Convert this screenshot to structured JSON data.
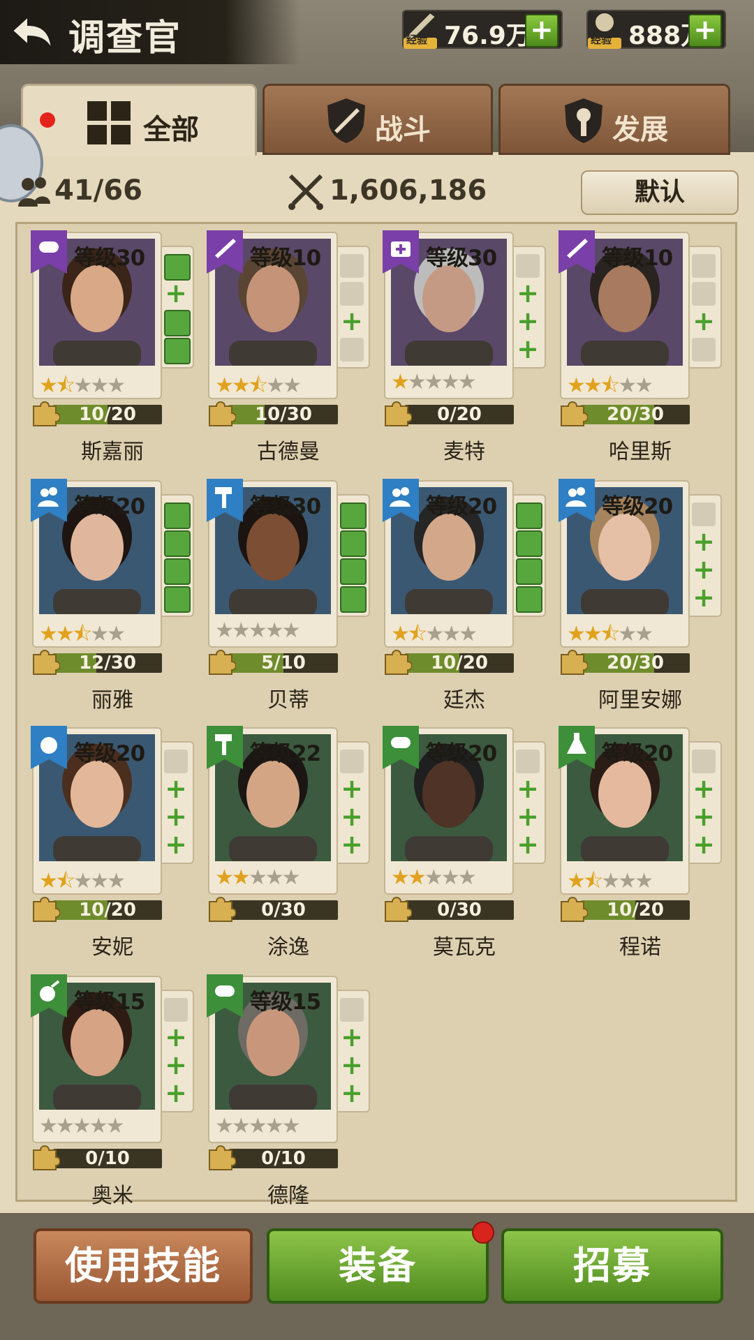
{
  "header": {
    "title": "调查官"
  },
  "resources": [
    {
      "icon": "rifle-exp-icon",
      "tag": "经验",
      "value": "76.9万"
    },
    {
      "icon": "wrench-exp-icon",
      "tag": "经验",
      "value": "888万"
    }
  ],
  "tabs": [
    {
      "label": "全部",
      "icon": "grid-icon",
      "active": true
    },
    {
      "label": "战斗",
      "icon": "combat-shield-icon",
      "active": false
    },
    {
      "label": "发展",
      "icon": "wrench-shield-icon",
      "active": false
    }
  ],
  "stats": {
    "count": "41/66",
    "power": "1,606,186",
    "sort_label": "默认"
  },
  "level_prefix": "等级",
  "investigators": [
    {
      "name": "斯嘉丽",
      "level": "30",
      "badge_color": "#7a3fa8",
      "badge_icon": "roll-icon",
      "stars": 1.5,
      "progress": "10/20",
      "pct": 0.5,
      "slots": [
        "gear",
        "plus",
        "gear",
        "gear"
      ],
      "bg": "#5a4868",
      "skin": "#d9a887",
      "hair": "#3b2418"
    },
    {
      "name": "古德曼",
      "level": "10",
      "badge_color": "#7a3fa8",
      "badge_icon": "rifle-icon",
      "stars": 2.5,
      "progress": "10/30",
      "pct": 0.33,
      "slots": [
        "empty",
        "empty",
        "plus",
        "empty"
      ],
      "bg": "#5a4868",
      "skin": "#c59478",
      "hair": "#5a4433"
    },
    {
      "name": "麦特",
      "level": "30",
      "badge_color": "#7a3fa8",
      "badge_icon": "medkit-icon",
      "stars": 1,
      "progress": "0/20",
      "pct": 0,
      "slots": [
        "empty",
        "plus",
        "plus",
        "plus"
      ],
      "bg": "#5a4868",
      "skin": "#c59a85",
      "hair": "#bcbcbc"
    },
    {
      "name": "哈里斯",
      "level": "10",
      "badge_color": "#7a3fa8",
      "badge_icon": "rifle-icon",
      "stars": 2.5,
      "progress": "20/30",
      "pct": 0.67,
      "slots": [
        "empty",
        "empty",
        "plus",
        "empty"
      ],
      "bg": "#5a4868",
      "skin": "#a87a5f",
      "hair": "#2a2420"
    },
    {
      "name": "丽雅",
      "level": "20",
      "badge_color": "#2f7fc4",
      "badge_icon": "people-icon",
      "stars": 2.5,
      "progress": "12/30",
      "pct": 0.4,
      "slots": [
        "gear",
        "gear",
        "gear",
        "gear"
      ],
      "bg": "#3b5872",
      "skin": "#e0b79c",
      "hair": "#1e1512"
    },
    {
      "name": "贝蒂",
      "level": "30",
      "badge_color": "#2f7fc4",
      "badge_icon": "hammer-icon",
      "stars": 0,
      "progress": "5/10",
      "pct": 0.5,
      "slots": [
        "gear",
        "gear",
        "gear",
        "gear"
      ],
      "bg": "#3b5872",
      "skin": "#7c4e34",
      "hair": "#1b1410"
    },
    {
      "name": "廷杰",
      "level": "20",
      "badge_color": "#2f7fc4",
      "badge_icon": "people-icon",
      "stars": 1.5,
      "progress": "10/20",
      "pct": 0.5,
      "slots": [
        "gear",
        "gear",
        "gear",
        "gear"
      ],
      "bg": "#3b5872",
      "skin": "#d3a88a",
      "hair": "#262626"
    },
    {
      "name": "阿里安娜",
      "level": "20",
      "badge_color": "#2f7fc4",
      "badge_icon": "people-icon",
      "stars": 2.5,
      "progress": "20/30",
      "pct": 0.67,
      "slots": [
        "empty",
        "plus",
        "plus",
        "plus"
      ],
      "bg": "#3b5872",
      "skin": "#e6c0a6",
      "hair": "#a6845e"
    },
    {
      "name": "安妮",
      "level": "20",
      "badge_color": "#2f7fc4",
      "badge_icon": "tomato-icon",
      "stars": 1.5,
      "progress": "10/20",
      "pct": 0.5,
      "slots": [
        "empty",
        "plus",
        "plus",
        "plus"
      ],
      "bg": "#3b5872",
      "skin": "#e3b799",
      "hair": "#4b2e1e"
    },
    {
      "name": "涂逸",
      "level": "22",
      "badge_color": "#3d8f3a",
      "badge_icon": "hammer-icon",
      "stars": 2,
      "progress": "0/30",
      "pct": 0,
      "slots": [
        "empty",
        "plus",
        "plus",
        "plus"
      ],
      "bg": "#3c5a40",
      "skin": "#d4a585",
      "hair": "#1b1613"
    },
    {
      "name": "莫瓦克",
      "level": "20",
      "badge_color": "#3d8f3a",
      "badge_icon": "roll-icon",
      "stars": 2,
      "progress": "0/30",
      "pct": 0,
      "slots": [
        "empty",
        "plus",
        "plus",
        "plus"
      ],
      "bg": "#3c5a40",
      "skin": "#4f3326",
      "hair": "#1f1f1f"
    },
    {
      "name": "程诺",
      "level": "20",
      "badge_color": "#3d8f3a",
      "badge_icon": "flask-icon",
      "stars": 1.5,
      "progress": "10/20",
      "pct": 0.5,
      "slots": [
        "empty",
        "plus",
        "plus",
        "plus"
      ],
      "bg": "#3c5a40",
      "skin": "#e4b99d",
      "hair": "#2b1c16"
    },
    {
      "name": "奥米",
      "level": "15",
      "badge_color": "#3d8f3a",
      "badge_icon": "veggie-icon",
      "stars": 0,
      "progress": "0/10",
      "pct": 0,
      "slots": [
        "empty",
        "plus",
        "plus",
        "plus"
      ],
      "bg": "#3c5a40",
      "skin": "#d6a384",
      "hair": "#2e1c14"
    },
    {
      "name": "德隆",
      "level": "15",
      "badge_color": "#3d8f3a",
      "badge_icon": "roll-icon",
      "stars": 0,
      "progress": "0/10",
      "pct": 0,
      "slots": [
        "empty",
        "plus",
        "plus",
        "plus"
      ],
      "bg": "#3c5a40",
      "skin": "#c8977b",
      "hair": "#6e6a64"
    }
  ],
  "bottom_buttons": [
    {
      "label": "使用技能",
      "style": "brown"
    },
    {
      "label": "装备",
      "style": "green",
      "notify": true
    },
    {
      "label": "招募",
      "style": "green"
    }
  ]
}
